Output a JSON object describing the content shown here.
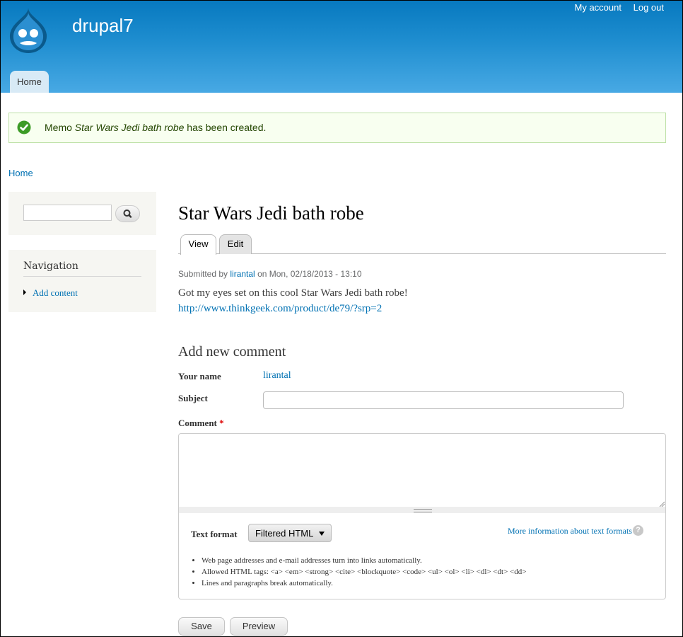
{
  "header": {
    "site_name": "drupal7",
    "secondary_menu": [
      "My account",
      "Log out"
    ],
    "main_tab": "Home",
    "background_color": "#1f8ed0"
  },
  "message": {
    "prefix": "Memo ",
    "title": "Star Wars Jedi bath robe",
    "suffix": " has been created.",
    "icon": "check-circle-icon",
    "status_color": "#3c9b26"
  },
  "breadcrumb": "Home",
  "sidebar": {
    "search": {
      "value": "",
      "button_icon": "search-icon"
    },
    "navigation": {
      "title": "Navigation",
      "items": [
        "Add content"
      ]
    }
  },
  "node": {
    "title": "Star Wars Jedi bath robe",
    "tabs": [
      "View",
      "Edit"
    ],
    "submitted": {
      "prefix": "Submitted by ",
      "author": "lirantal",
      "suffix": " on Mon, 02/18/2013 - 13:10"
    },
    "body": "Got my eyes set on this cool Star Wars Jedi bath robe!",
    "link": "http://www.thinkgeek.com/product/de79/?srp=2"
  },
  "comment_form": {
    "title": "Add new comment",
    "your_name_label": "Your name",
    "your_name_value": "lirantal",
    "subject_label": "Subject",
    "subject_value": "",
    "comment_label": "Comment",
    "required_marker": "*",
    "comment_value": "",
    "text_format_label": "Text format",
    "text_format_value": "Filtered HTML",
    "text_format_help": "More information about text formats",
    "tips": [
      "Web page addresses and e-mail addresses turn into links automatically.",
      "Allowed HTML tags: <a> <em> <strong> <cite> <blockquote> <code> <ul> <ol> <li> <dl> <dt> <dd>",
      "Lines and paragraphs break automatically."
    ],
    "save_label": "Save",
    "preview_label": "Preview"
  }
}
